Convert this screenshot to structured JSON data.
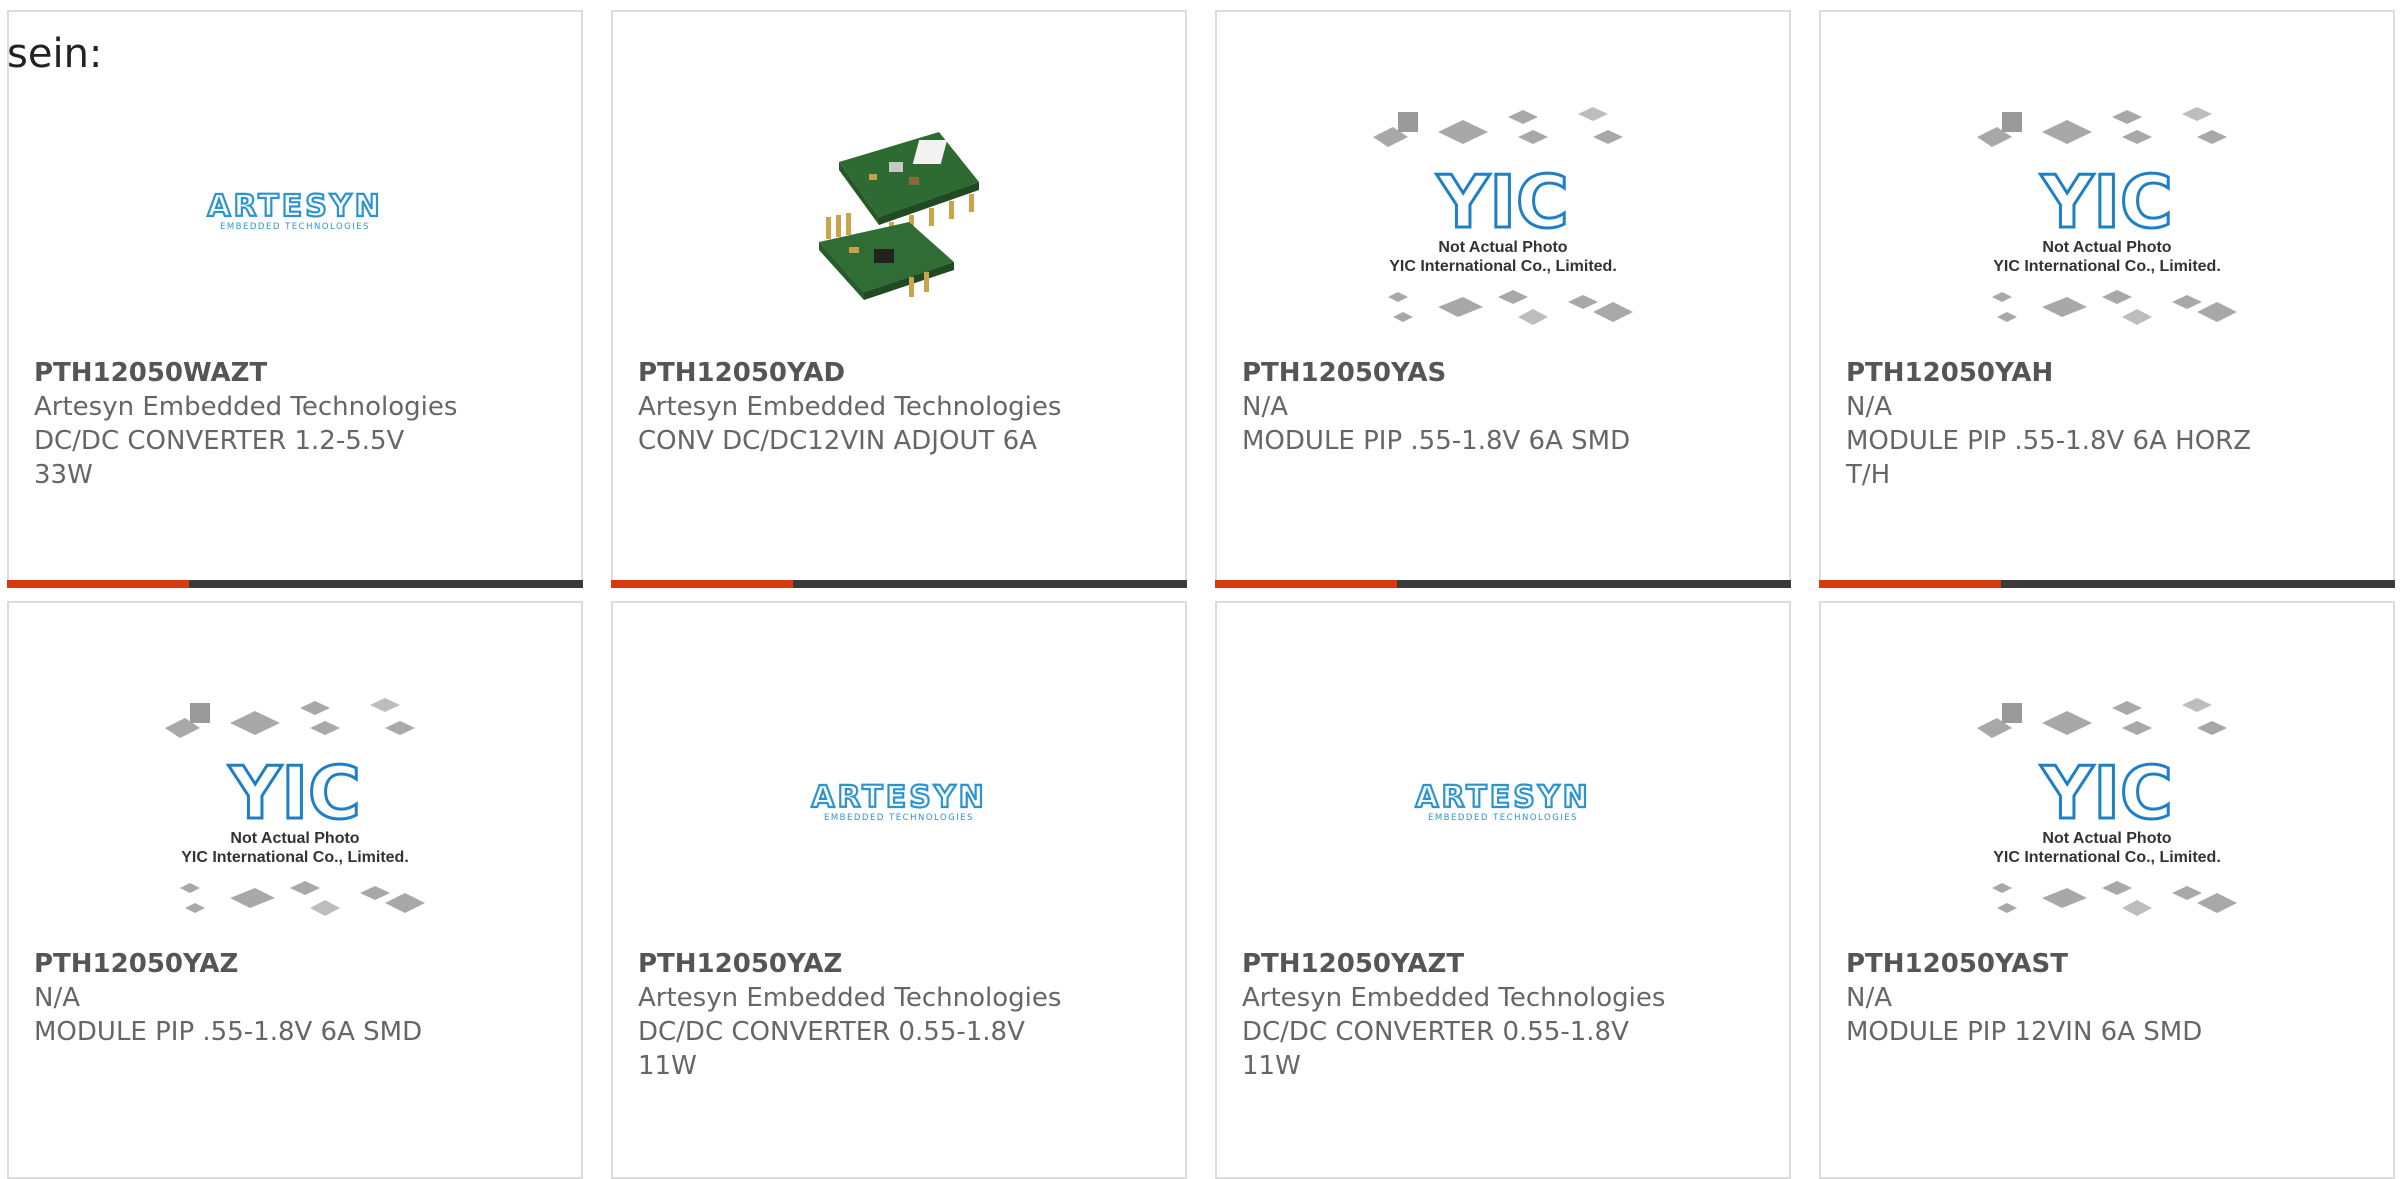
{
  "header": {
    "text": "sein:"
  },
  "colors": {
    "accent": "#d8390f",
    "bar": "#3a3a3a",
    "card_border": "#dcdcdc",
    "text": "#666666",
    "yic_blue": "#1f7fc4",
    "artesyn_blue": "#2b94d0"
  },
  "image_text": {
    "artesyn_logo": "ARTESYN",
    "artesyn_sub": "EMBEDDED TECHNOLOGIES",
    "yic_logo": "YIC",
    "yic_line1": "Not Actual Photo",
    "yic_line2": "YIC International Co., Limited."
  },
  "products": [
    {
      "part": "PTH12050WAZT",
      "manufacturer": "Artesyn Embedded Technologies",
      "description": "DC/DC CONVERTER 1.2-5.5V\n33W",
      "image": "artesyn-logo"
    },
    {
      "part": "PTH12050YAD",
      "manufacturer": "Artesyn Embedded Technologies",
      "description": "CONV DC/DC12VIN ADJOUT 6A",
      "image": "module-photo"
    },
    {
      "part": "PTH12050YAS",
      "manufacturer": "N/A",
      "description": "MODULE PIP .55-1.8V 6A SMD",
      "image": "yic-placeholder"
    },
    {
      "part": "PTH12050YAH",
      "manufacturer": "N/A",
      "description": "MODULE PIP .55-1.8V 6A HORZ\nT/H",
      "image": "yic-placeholder"
    },
    {
      "part": "PTH12050YAZ",
      "manufacturer": "N/A",
      "description": "MODULE PIP .55-1.8V 6A SMD",
      "image": "yic-placeholder"
    },
    {
      "part": "PTH12050YAZ",
      "manufacturer": "Artesyn Embedded Technologies",
      "description": "DC/DC CONVERTER 0.55-1.8V\n11W",
      "image": "artesyn-logo"
    },
    {
      "part": "PTH12050YAZT",
      "manufacturer": "Artesyn Embedded Technologies",
      "description": "DC/DC CONVERTER 0.55-1.8V\n11W",
      "image": "artesyn-logo"
    },
    {
      "part": "PTH12050YAST",
      "manufacturer": "N/A",
      "description": "MODULE PIP 12VIN 6A SMD",
      "image": "yic-placeholder"
    }
  ]
}
